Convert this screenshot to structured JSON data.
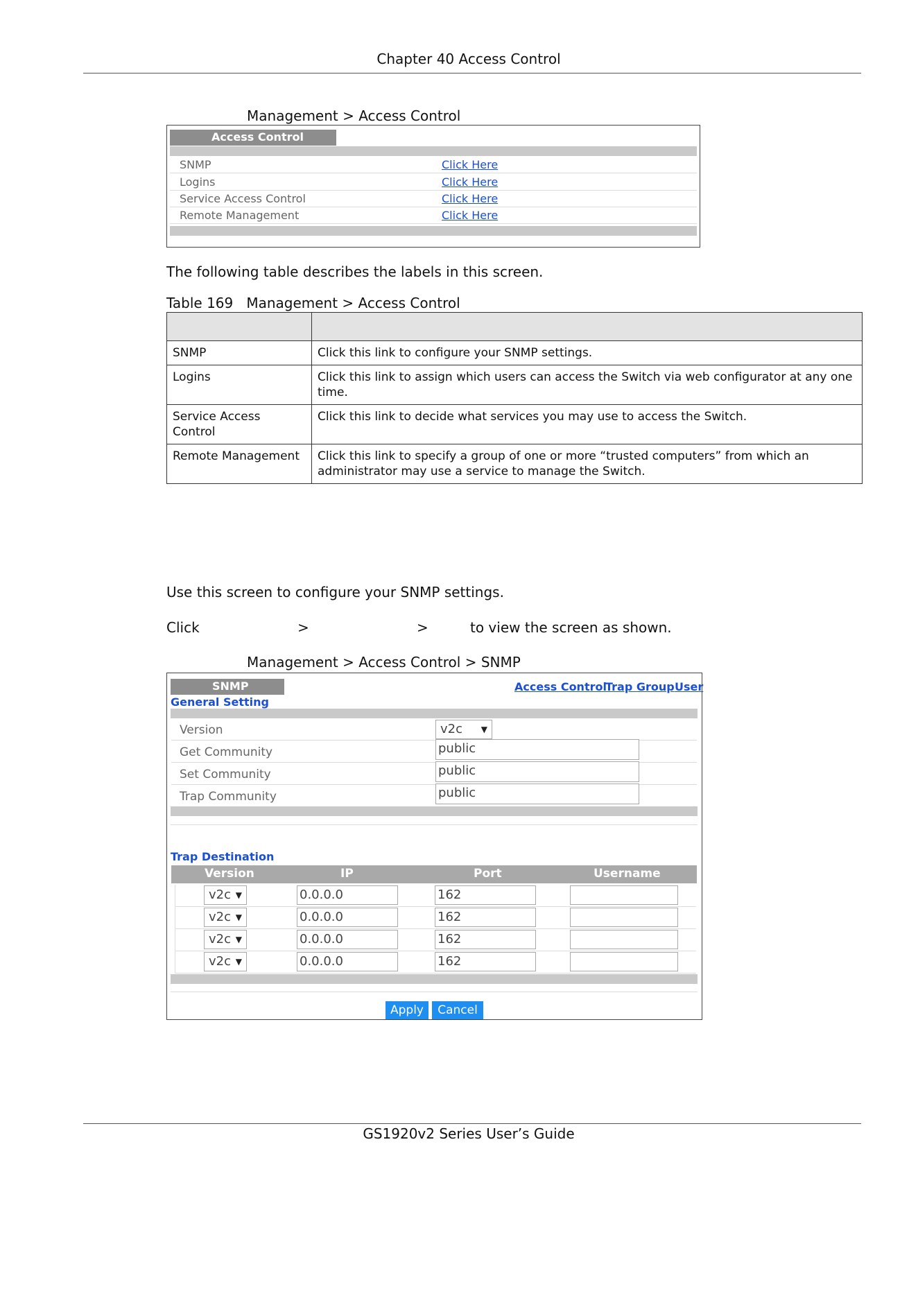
{
  "header": {
    "chapter": "Chapter 40 Access Control"
  },
  "figure1": {
    "caption": "Management > Access Control",
    "tab_title": "Access Control",
    "rows": [
      {
        "label": "SNMP",
        "link": "Click Here"
      },
      {
        "label": "Logins",
        "link": "Click Here"
      },
      {
        "label": "Service Access Control",
        "link": "Click Here"
      },
      {
        "label": "Remote Management",
        "link": "Click Here"
      }
    ]
  },
  "intro_text": "The following table describes the labels in this screen.",
  "table": {
    "caption": "Table 169   Management > Access Control",
    "rows": [
      {
        "label": "SNMP",
        "desc": "Click this link to configure your SNMP settings."
      },
      {
        "label": "Logins",
        "desc": "Click this link to assign which users can access the Switch via web configurator at any one time."
      },
      {
        "label": "Service Access Control",
        "desc": "Click this link to decide what services you may use to access the Switch."
      },
      {
        "label": "Remote Management",
        "desc": "Click this link to specify a group of one or more “trusted computers” from which an administrator may use a service to manage the Switch."
      }
    ]
  },
  "section_text": "Use this screen to configure your SNMP settings.",
  "click_line": {
    "click": "Click",
    "sep1": ">",
    "sep2": ">",
    "rest": "to view the screen as shown."
  },
  "figure2": {
    "caption": "Management > Access Control > SNMP",
    "tab_title": "SNMP",
    "top_links": {
      "access_control": "Access Control",
      "trap_group": "Trap Group",
      "user": "User"
    },
    "general_setting": {
      "title": "General Setting",
      "version_label": "Version",
      "version_value": "v2c",
      "get_label": "Get Community",
      "get_value": "public",
      "set_label": "Set Community",
      "set_value": "public",
      "trap_label": "Trap Community",
      "trap_value": "public"
    },
    "trap_destination": {
      "title": "Trap Destination",
      "columns": {
        "version": "Version",
        "ip": "IP",
        "port": "Port",
        "username": "Username"
      },
      "rows": [
        {
          "version": "v2c",
          "ip": "0.0.0.0",
          "port": "162",
          "username": ""
        },
        {
          "version": "v2c",
          "ip": "0.0.0.0",
          "port": "162",
          "username": ""
        },
        {
          "version": "v2c",
          "ip": "0.0.0.0",
          "port": "162",
          "username": ""
        },
        {
          "version": "v2c",
          "ip": "0.0.0.0",
          "port": "162",
          "username": ""
        }
      ]
    },
    "buttons": {
      "apply": "Apply",
      "cancel": "Cancel"
    }
  },
  "footer": {
    "guide": "GS1920v2 Series User’s Guide"
  },
  "colors": {
    "link": "#1a4fd6",
    "button": "#1e8ef0",
    "tab_header": "#8d8d8d",
    "gray_bar": "#c9c9c9"
  }
}
